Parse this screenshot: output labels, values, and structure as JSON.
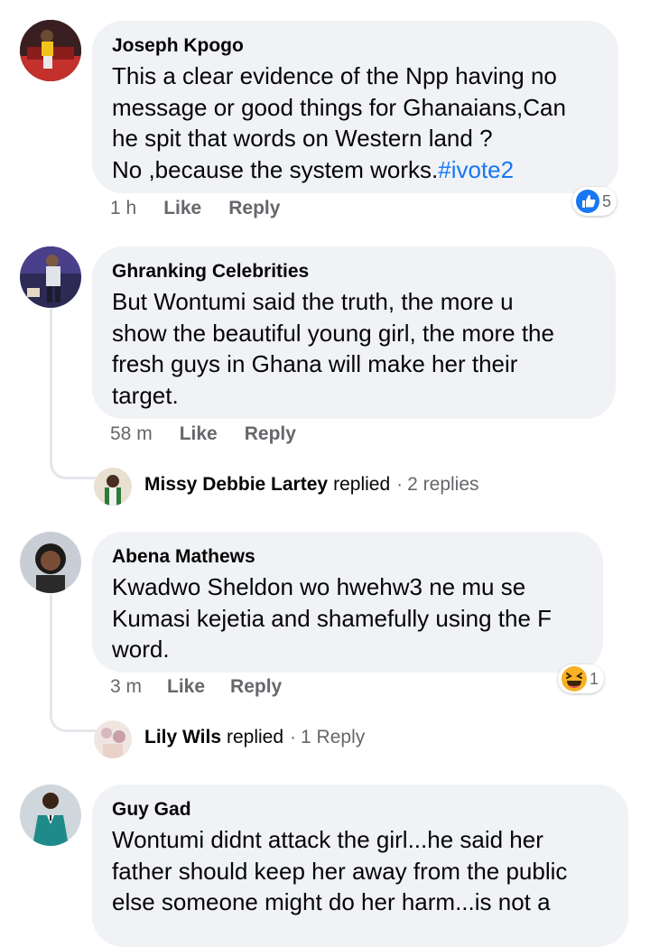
{
  "comments": [
    {
      "author": "Joseph Kpogo",
      "lines": [
        "This a clear evidence of the Npp having no",
        "message or good things for Ghanaians,Can",
        "he spit that words on Western land ?",
        "No ,because the system works."
      ],
      "hashtag": "#ivote2",
      "time": "1 h",
      "like_label": "Like",
      "reply_label": "Reply",
      "reaction": {
        "icon": "like-icon",
        "count": "5"
      }
    },
    {
      "author": "Ghranking Celebrities",
      "lines": [
        "But Wontumi said the truth, the more u",
        "show the beautiful young girl, the more the",
        "fresh guys in Ghana will make her their",
        "target."
      ],
      "time": "58 m",
      "like_label": "Like",
      "reply_label": "Reply",
      "replies": {
        "name": "Missy Debbie Lartey",
        "verb": "replied",
        "separator": "·",
        "count_label": "2 replies"
      }
    },
    {
      "author": "Abena Mathews",
      "lines": [
        "Kwadwo Sheldon wo hwehw3 ne mu se",
        "Kumasi kejetia and shamefully using the F",
        "word."
      ],
      "time": "3 m",
      "like_label": "Like",
      "reply_label": "Reply",
      "reaction": {
        "icon": "haha-icon",
        "count": "1"
      },
      "replies": {
        "name": "Lily Wils",
        "verb": "replied",
        "separator": "·",
        "count_label": "1 Reply"
      }
    },
    {
      "author": "Guy Gad",
      "lines": [
        "Wontumi didnt attack the girl...he said her",
        "father should keep her away from the public",
        "else someone might do her harm...is not a"
      ]
    }
  ],
  "colors": {
    "bubble": "#f0f2f5",
    "link": "#1877f2",
    "meta": "#65676b"
  }
}
